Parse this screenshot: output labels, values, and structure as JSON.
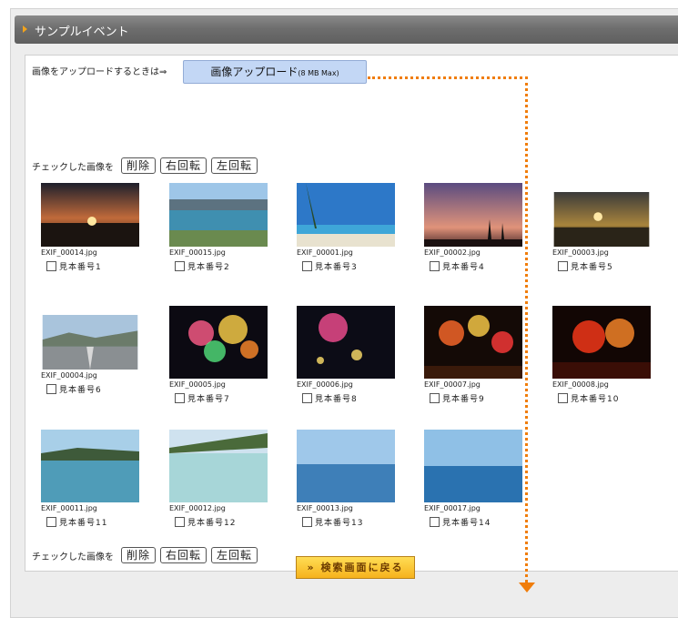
{
  "header": {
    "title": "サンプルイベント"
  },
  "upload": {
    "prompt": "画像をアップロードするときは⇒",
    "button_label": "画像アップロード",
    "button_note": "(8 MB Max)"
  },
  "toolbar": {
    "label": "チェックした画像を",
    "delete": "削除",
    "rotate_right": "右回転",
    "rotate_left": "左回転"
  },
  "photos": [
    {
      "file": "EXIF_00014.jpg",
      "label": "見本番号1"
    },
    {
      "file": "EXIF_00015.jpg",
      "label": "見本番号2"
    },
    {
      "file": "EXIF_00001.jpg",
      "label": "見本番号3"
    },
    {
      "file": "EXIF_00002.jpg",
      "label": "見本番号4"
    },
    {
      "file": "EXIF_00003.jpg",
      "label": "見本番号5"
    },
    {
      "file": "EXIF_00004.jpg",
      "label": "見本番号6"
    },
    {
      "file": "EXIF_00005.jpg",
      "label": "見本番号7"
    },
    {
      "file": "EXIF_00006.jpg",
      "label": "見本番号8"
    },
    {
      "file": "EXIF_00007.jpg",
      "label": "見本番号9"
    },
    {
      "file": "EXIF_00008.jpg",
      "label": "見本番号10"
    },
    {
      "file": "EXIF_00011.jpg",
      "label": "見本番号11"
    },
    {
      "file": "EXIF_00012.jpg",
      "label": "見本番号12"
    },
    {
      "file": "EXIF_00013.jpg",
      "label": "見本番号13"
    },
    {
      "file": "EXIF_00017.jpg",
      "label": "見本番号14"
    }
  ],
  "footer": {
    "back_button": "» 検索画面に戻る"
  },
  "colors": {
    "accent_orange": "#f07d0a",
    "header_gray": "#6e6e6e",
    "upload_blue": "#c3d7f5"
  }
}
